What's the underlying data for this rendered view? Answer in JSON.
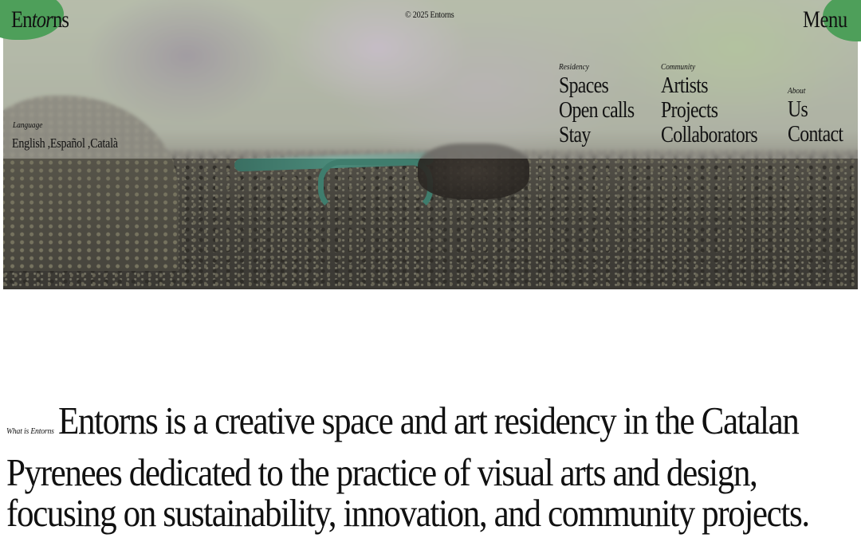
{
  "brand": {
    "logo_prefix": "En",
    "logo_italic": "tor",
    "logo_suffix": "ns",
    "accent_color": "#4e9f5a"
  },
  "header": {
    "copyright": "© 2025 Entorns",
    "menu_label": "Menu"
  },
  "language": {
    "label": "Language",
    "options": [
      "English ,",
      "Español ,",
      "Català"
    ]
  },
  "nav": {
    "residency": {
      "label": "Residency",
      "items": [
        "Spaces",
        "Open calls",
        "Stay"
      ]
    },
    "community": {
      "label": "Community",
      "items": [
        "Artists",
        "Projects",
        "Collaborators"
      ]
    },
    "about": {
      "label": "About",
      "items": [
        "Us",
        "Contact"
      ]
    }
  },
  "intro": {
    "tag": "What is Entorns",
    "text": "Entorns is a creative space and art residency in the Catalan Pyrenees dedicated to the practice of visual arts and design, focusing on sustainability, innovation, and community projects."
  }
}
